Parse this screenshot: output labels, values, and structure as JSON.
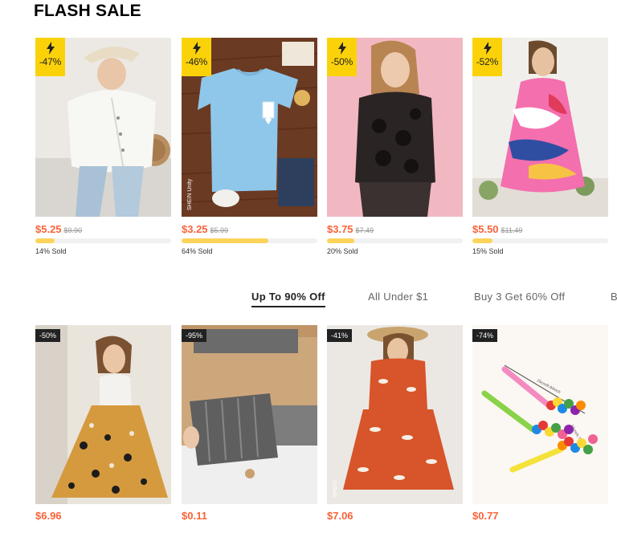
{
  "section_title": "FLASH SALE",
  "flash_items": [
    {
      "discount": "-47%",
      "price": "$5.25",
      "old_price": "$9.90",
      "sold_pct": 14,
      "sold_label": "14% Sold",
      "product": "white asymmetric button blouse"
    },
    {
      "discount": "-46%",
      "price": "$3.25",
      "old_price": "$5.99",
      "sold_pct": 64,
      "sold_label": "64% Sold",
      "product": "blue queen card t-shirt",
      "print_text": "SHEIN Unity"
    },
    {
      "discount": "-50%",
      "price": "$3.75",
      "old_price": "$7.49",
      "sold_pct": 20,
      "sold_label": "20% Sold",
      "product": "black sheer floral tank top"
    },
    {
      "discount": "-52%",
      "price": "$5.50",
      "old_price": "$11.49",
      "sold_pct": 15,
      "sold_label": "15% Sold",
      "product": "pink abstract halter dress"
    }
  ],
  "tabs": [
    {
      "label": "Up To 90% Off",
      "active": true
    },
    {
      "label": "All Under $1",
      "active": false
    },
    {
      "label": "Buy 3 Get 60% Off",
      "active": false
    },
    {
      "label": "B",
      "active": false
    }
  ],
  "grid_items": [
    {
      "discount": "-50%",
      "price": "$6.96",
      "product": "floral maxi skirt outfit"
    },
    {
      "discount": "-95%",
      "price": "$0.11",
      "product": "grey fabric storage organizer box"
    },
    {
      "discount": "-41%",
      "price": "$7.06",
      "product": "orange leaf print sleeveless dress",
      "print_text": "SHEIN"
    },
    {
      "discount": "-74%",
      "price": "$0.77",
      "product": "water balloon bunch set",
      "print_text": [
        "25cm/9.84inch",
        "12cm/4.72inch"
      ]
    }
  ],
  "colors": {
    "accent_price": "#fa6338",
    "flash_badge": "#fbd20a",
    "progress": "#fdd35a"
  }
}
